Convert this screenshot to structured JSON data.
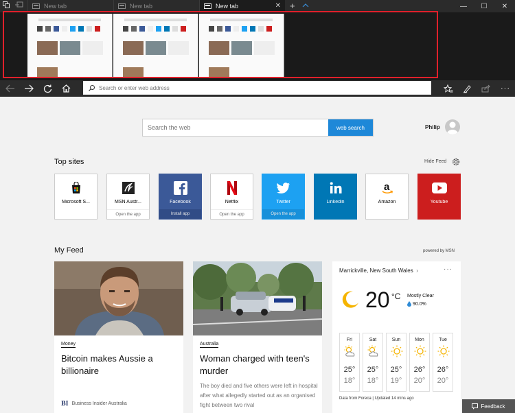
{
  "tabs": [
    {
      "label": "New tab"
    },
    {
      "label": "New tab"
    },
    {
      "label": "New tab",
      "active": true
    }
  ],
  "address_bar": {
    "placeholder": "Search or enter web address"
  },
  "search": {
    "placeholder": "Search the web",
    "button": "web search"
  },
  "user": {
    "name": "Philip"
  },
  "top_sites": {
    "title": "Top sites",
    "hide_feed": "Hide Feed",
    "items": [
      {
        "label": "Microsoft S...",
        "sub": "",
        "icon": "microsoft-store-icon"
      },
      {
        "label": "MSN Austr...",
        "sub": "Open the app",
        "icon": "msn-icon"
      },
      {
        "label": "Facebook",
        "sub": "Install app",
        "icon": "facebook-icon",
        "color": "#3b5998"
      },
      {
        "label": "Netflix",
        "sub": "Open the app",
        "icon": "netflix-icon",
        "color": "#e50914"
      },
      {
        "label": "Twitter",
        "sub": "Open the app",
        "icon": "twitter-icon",
        "color": "#1da1f2"
      },
      {
        "label": "Linkedin",
        "sub": "",
        "icon": "linkedin-icon",
        "color": "#0077b5"
      },
      {
        "label": "Amazon",
        "sub": "",
        "icon": "amazon-icon"
      },
      {
        "label": "Youtube",
        "sub": "",
        "icon": "youtube-icon",
        "color": "#cc1e1e"
      }
    ]
  },
  "feed": {
    "title": "My Feed",
    "powered": "powered by MSN",
    "articles": [
      {
        "category": "Money",
        "headline": "Bitcoin makes Aussie a billionaire",
        "body": "",
        "source_logo": "BI",
        "source": "Business Insider Australia"
      },
      {
        "category": "Australia",
        "headline": "Woman charged with teen's murder",
        "body": "The boy died and five others were left in hospital after what allegedly started out as an organised fight between two rival",
        "source_logo": "",
        "source": ""
      }
    ]
  },
  "weather": {
    "location": "Marrickville, New South Wales",
    "temp": "20",
    "unit": "°C",
    "condition": "Mostly Clear",
    "humidity": "90.0%",
    "forecast": [
      {
        "day": "Fri",
        "hi": "25°",
        "lo": "18°",
        "icon": "partly-cloudy-icon"
      },
      {
        "day": "Sat",
        "hi": "25°",
        "lo": "18°",
        "icon": "partly-cloudy-icon"
      },
      {
        "day": "Sun",
        "hi": "25°",
        "lo": "19°",
        "icon": "sun-icon"
      },
      {
        "day": "Mon",
        "hi": "26°",
        "lo": "20°",
        "icon": "sun-icon"
      },
      {
        "day": "Tue",
        "hi": "26°",
        "lo": "20°",
        "icon": "sun-icon"
      }
    ],
    "footer": "Data from Foreca | Updated 14 mins ago"
  },
  "feedback": {
    "label": "Feedback"
  },
  "colors": {
    "accent": "#1e88d8",
    "highlight_frame": "#e0202b",
    "chrome": "#2b2b2b"
  }
}
